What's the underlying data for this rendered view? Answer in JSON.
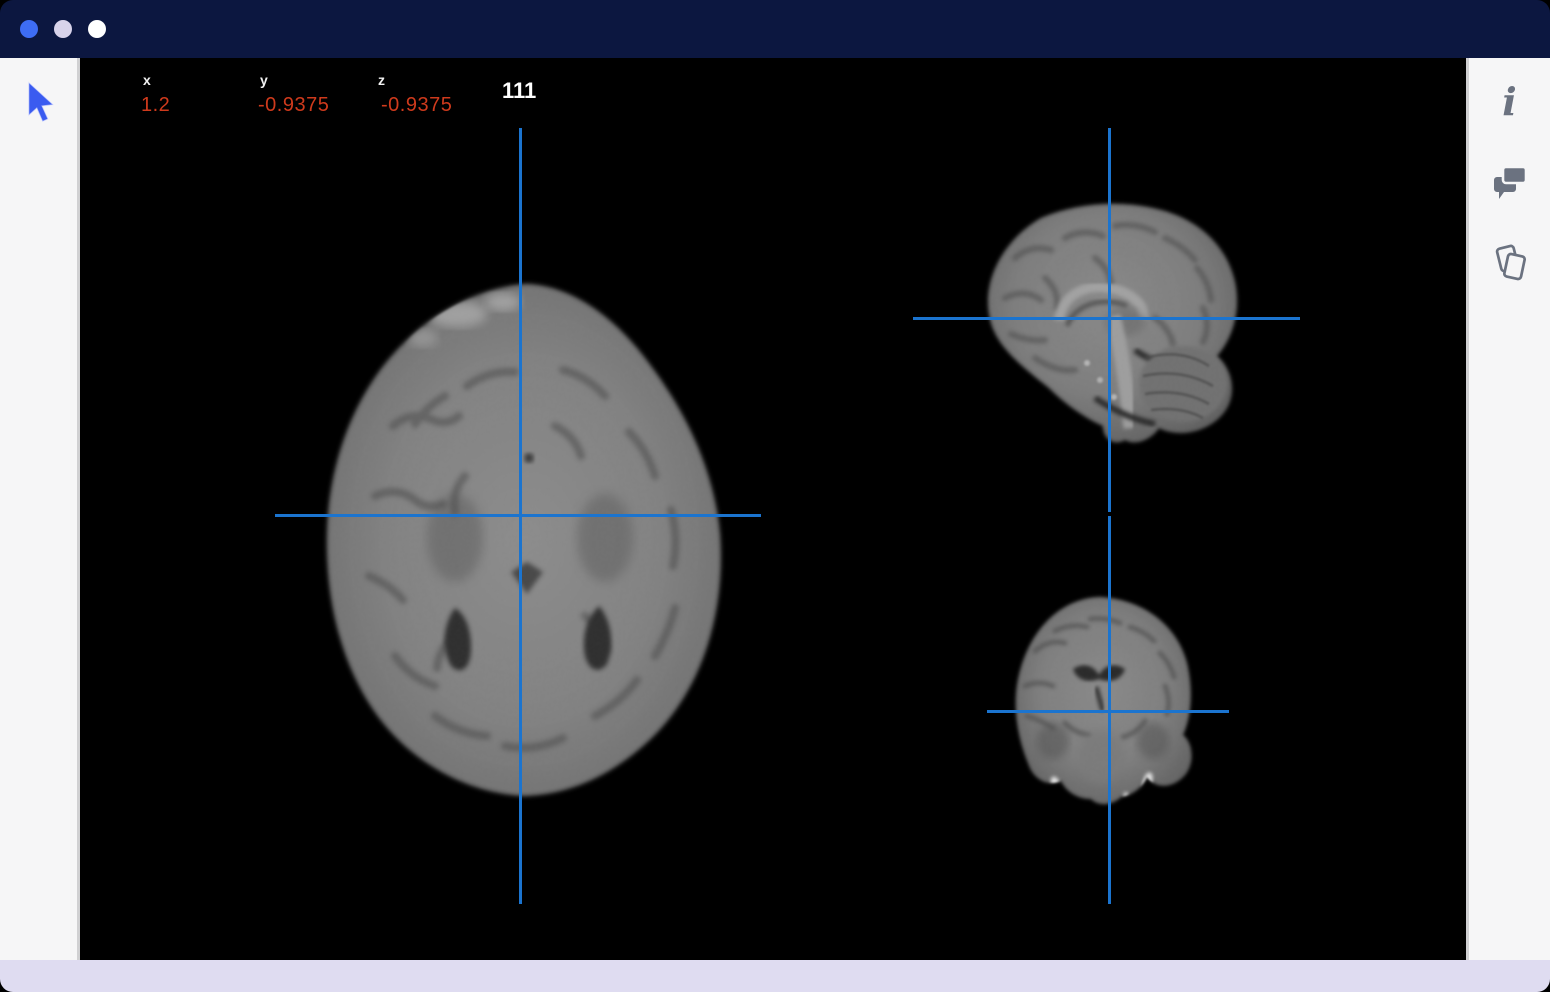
{
  "colors": {
    "titlebar-bg": "#0c1740",
    "canvas-bg": "#000000",
    "rail-bg": "#f6f6f7",
    "rail-border": "#d0d0d2",
    "bottombar-bg": "#dfdcf1",
    "crosshair": "#1b74cf",
    "coord-label": "#f2f2f2",
    "coord-value": "#cf3a1c",
    "intensity": "#ffffff",
    "icon": "#6b7280",
    "cursor": "#3a5bf0",
    "dot-1": "#3e6df4",
    "dot-2": "#d8d3ea",
    "dot-3": "#ffffff"
  },
  "viewer": {
    "coordinates": [
      {
        "axis": "x",
        "value": "1.2"
      },
      {
        "axis": "y",
        "value": "-0.9375"
      },
      {
        "axis": "z",
        "value": "-0.9375"
      }
    ],
    "intensity": "111",
    "views": [
      "axial",
      "sagittal",
      "coronal"
    ]
  },
  "sidebar_right": {
    "icons": [
      {
        "name": "info-icon",
        "glyph": "i"
      },
      {
        "name": "comments-icon"
      },
      {
        "name": "duplicate-pages-icon"
      }
    ]
  },
  "left_rail": {
    "icons": [
      {
        "name": "pointer-cursor-icon"
      }
    ]
  }
}
